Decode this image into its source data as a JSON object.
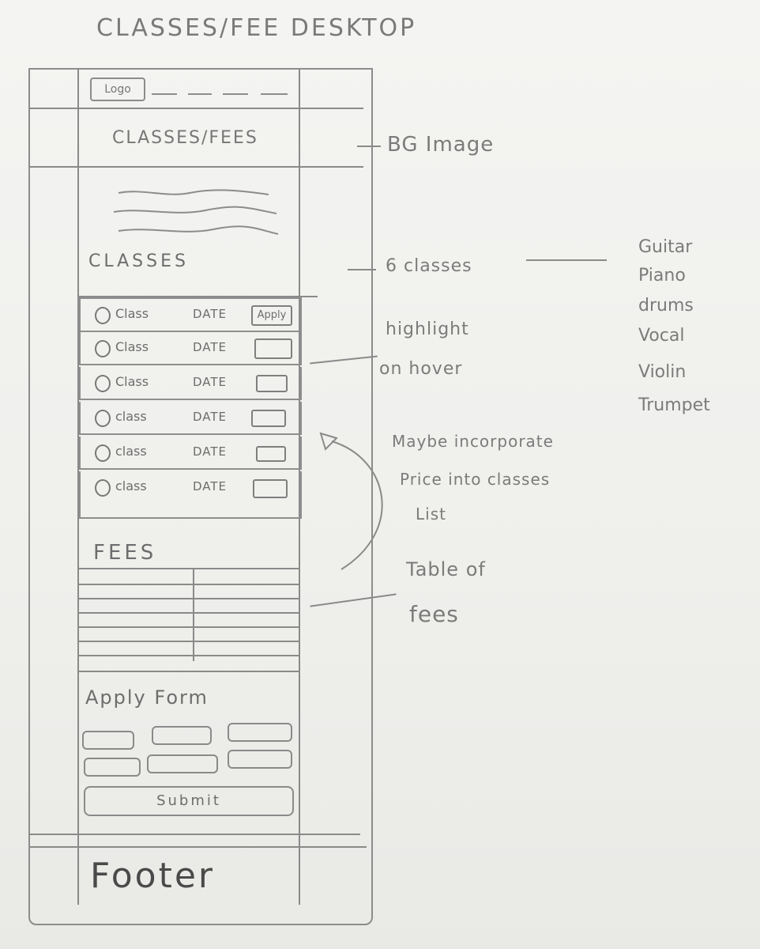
{
  "page_title": "CLASSES/FEE DESKTOP",
  "header": {
    "logo": "Logo"
  },
  "hero": {
    "title": "CLASSES/FEES",
    "annotation": "BG Image"
  },
  "classes": {
    "heading": "CLASSES",
    "annotation": "6 classes",
    "rows": [
      {
        "label": "Class",
        "date": "DATE",
        "button": "Apply"
      },
      {
        "label": "Class",
        "date": "DATE",
        "button": ""
      },
      {
        "label": "Class",
        "date": "DATE",
        "button": ""
      },
      {
        "label": "class",
        "date": "DATE",
        "button": ""
      },
      {
        "label": "class",
        "date": "DATE",
        "button": ""
      },
      {
        "label": "class",
        "date": "DATE",
        "button": ""
      }
    ],
    "class_list": [
      "Guitar",
      "Piano",
      "drums",
      "Vocal",
      "Violin",
      "Trumpet"
    ],
    "hover_note_line1": "highlight",
    "hover_note_line2": "on hover",
    "price_note_line1": "Maybe incorporate",
    "price_note_line2": "Price into classes",
    "price_note_line3": "List"
  },
  "fees": {
    "heading": "FEES",
    "annotation_line1": "Table of",
    "annotation_line2": "fees"
  },
  "apply_form": {
    "heading": "Apply Form",
    "submit": "Submit"
  },
  "footer": {
    "text": "Footer"
  }
}
